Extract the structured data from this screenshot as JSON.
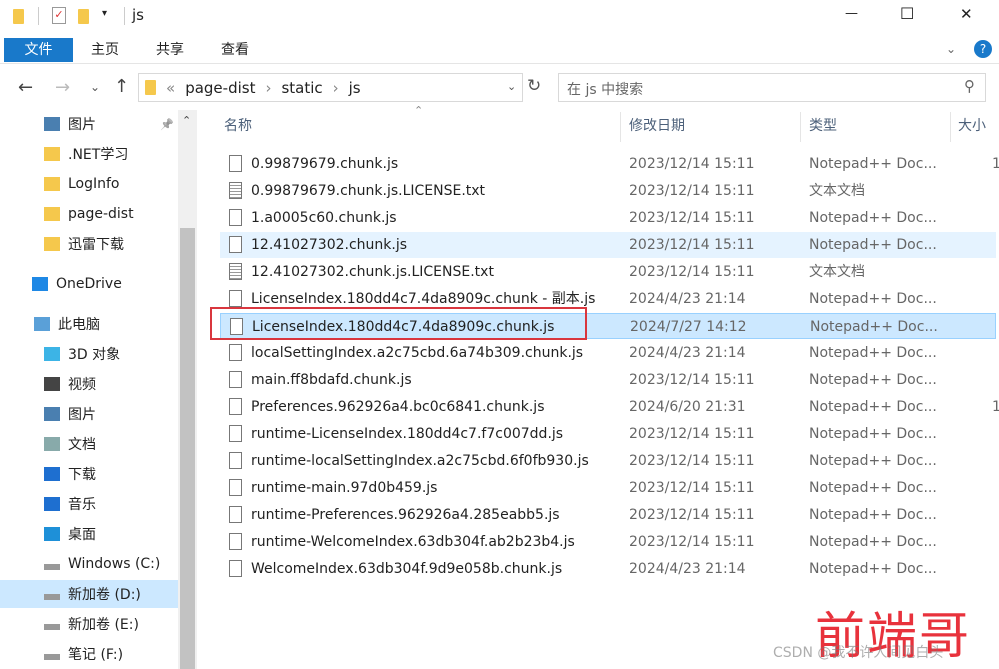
{
  "window": {
    "title": "js",
    "minimize": "—",
    "maximize": "☐",
    "close": "✕"
  },
  "ribbon": {
    "tabs": [
      "文件",
      "主页",
      "共享",
      "查看"
    ],
    "help": "?"
  },
  "nav": {
    "path": [
      "page-dist",
      "static",
      "js"
    ],
    "overflow": "«",
    "search_placeholder": "在 js 中搜索"
  },
  "sidebar": {
    "items": [
      {
        "label": "图片",
        "icon": "pictures-icon",
        "pinned": true
      },
      {
        "label": ".NET学习",
        "icon": "folder-icon"
      },
      {
        "label": "LogInfo",
        "icon": "folder-icon"
      },
      {
        "label": "page-dist",
        "icon": "folder-icon"
      },
      {
        "label": "迅雷下载",
        "icon": "folder-icon"
      },
      {
        "label": "OneDrive",
        "icon": "cloud-icon"
      },
      {
        "label": "此电脑",
        "icon": "computer-icon"
      },
      {
        "label": "3D 对象",
        "icon": "3d-objects-icon"
      },
      {
        "label": "视频",
        "icon": "video-icon"
      },
      {
        "label": "图片",
        "icon": "pictures-icon"
      },
      {
        "label": "文档",
        "icon": "documents-icon"
      },
      {
        "label": "下载",
        "icon": "download-icon"
      },
      {
        "label": "音乐",
        "icon": "music-icon"
      },
      {
        "label": "桌面",
        "icon": "desktop-icon"
      },
      {
        "label": "Windows (C:)",
        "icon": "drive-icon"
      },
      {
        "label": "新加卷 (D:)",
        "icon": "drive-icon",
        "selected": true
      },
      {
        "label": "新加卷 (E:)",
        "icon": "drive-icon"
      },
      {
        "label": "笔记 (F:)",
        "icon": "drive-icon"
      }
    ]
  },
  "columns": {
    "name": "名称",
    "date": "修改日期",
    "type": "类型",
    "size": "大小"
  },
  "files": [
    {
      "name": "0.99879679.chunk.js",
      "date": "2023/12/14 15:11",
      "type": "Notepad++ Doc...",
      "size": "1"
    },
    {
      "name": "0.99879679.chunk.js.LICENSE.txt",
      "date": "2023/12/14 15:11",
      "type": "文本文档",
      "size": ""
    },
    {
      "name": "1.a0005c60.chunk.js",
      "date": "2023/12/14 15:11",
      "type": "Notepad++ Doc...",
      "size": ""
    },
    {
      "name": "12.41027302.chunk.js",
      "date": "2023/12/14 15:11",
      "type": "Notepad++ Doc...",
      "size": "",
      "state": "hover"
    },
    {
      "name": "12.41027302.chunk.js.LICENSE.txt",
      "date": "2023/12/14 15:11",
      "type": "文本文档",
      "size": ""
    },
    {
      "name": "LicenseIndex.180dd4c7.4da8909c.chunk - 副本.js",
      "date": "2024/4/23 21:14",
      "type": "Notepad++ Doc...",
      "size": ""
    },
    {
      "name": "LicenseIndex.180dd4c7.4da8909c.chunk.js",
      "date": "2024/7/27 14:12",
      "type": "Notepad++ Doc...",
      "size": "",
      "state": "selected",
      "highlight": "#d9363e"
    },
    {
      "name": "localSettingIndex.a2c75cbd.6a74b309.chunk.js",
      "date": "2024/4/23 21:14",
      "type": "Notepad++ Doc...",
      "size": ""
    },
    {
      "name": "main.ff8bdafd.chunk.js",
      "date": "2023/12/14 15:11",
      "type": "Notepad++ Doc...",
      "size": ""
    },
    {
      "name": "Preferences.962926a4.bc0c6841.chunk.js",
      "date": "2024/6/20 21:31",
      "type": "Notepad++ Doc...",
      "size": "1"
    },
    {
      "name": "runtime-LicenseIndex.180dd4c7.f7c007dd.js",
      "date": "2023/12/14 15:11",
      "type": "Notepad++ Doc...",
      "size": ""
    },
    {
      "name": "runtime-localSettingIndex.a2c75cbd.6f0fb930.js",
      "date": "2023/12/14 15:11",
      "type": "Notepad++ Doc...",
      "size": ""
    },
    {
      "name": "runtime-main.97d0b459.js",
      "date": "2023/12/14 15:11",
      "type": "Notepad++ Doc...",
      "size": ""
    },
    {
      "name": "runtime-Preferences.962926a4.285eabb5.js",
      "date": "2023/12/14 15:11",
      "type": "Notepad++ Doc...",
      "size": ""
    },
    {
      "name": "runtime-WelcomeIndex.63db304f.ab2b23b4.js",
      "date": "2023/12/14 15:11",
      "type": "Notepad++ Doc...",
      "size": ""
    },
    {
      "name": "WelcomeIndex.63db304f.9d9e058b.chunk.js",
      "date": "2024/4/23 21:14",
      "type": "Notepad++ Doc...",
      "size": ""
    }
  ],
  "watermark": {
    "big": "前端哥",
    "small": "CSDN @我不许人间见白头"
  },
  "colors": {
    "accent": "#1979ca",
    "selected": "#cce8ff",
    "hover": "#e5f3ff",
    "highlight_box": "#d9363e"
  }
}
